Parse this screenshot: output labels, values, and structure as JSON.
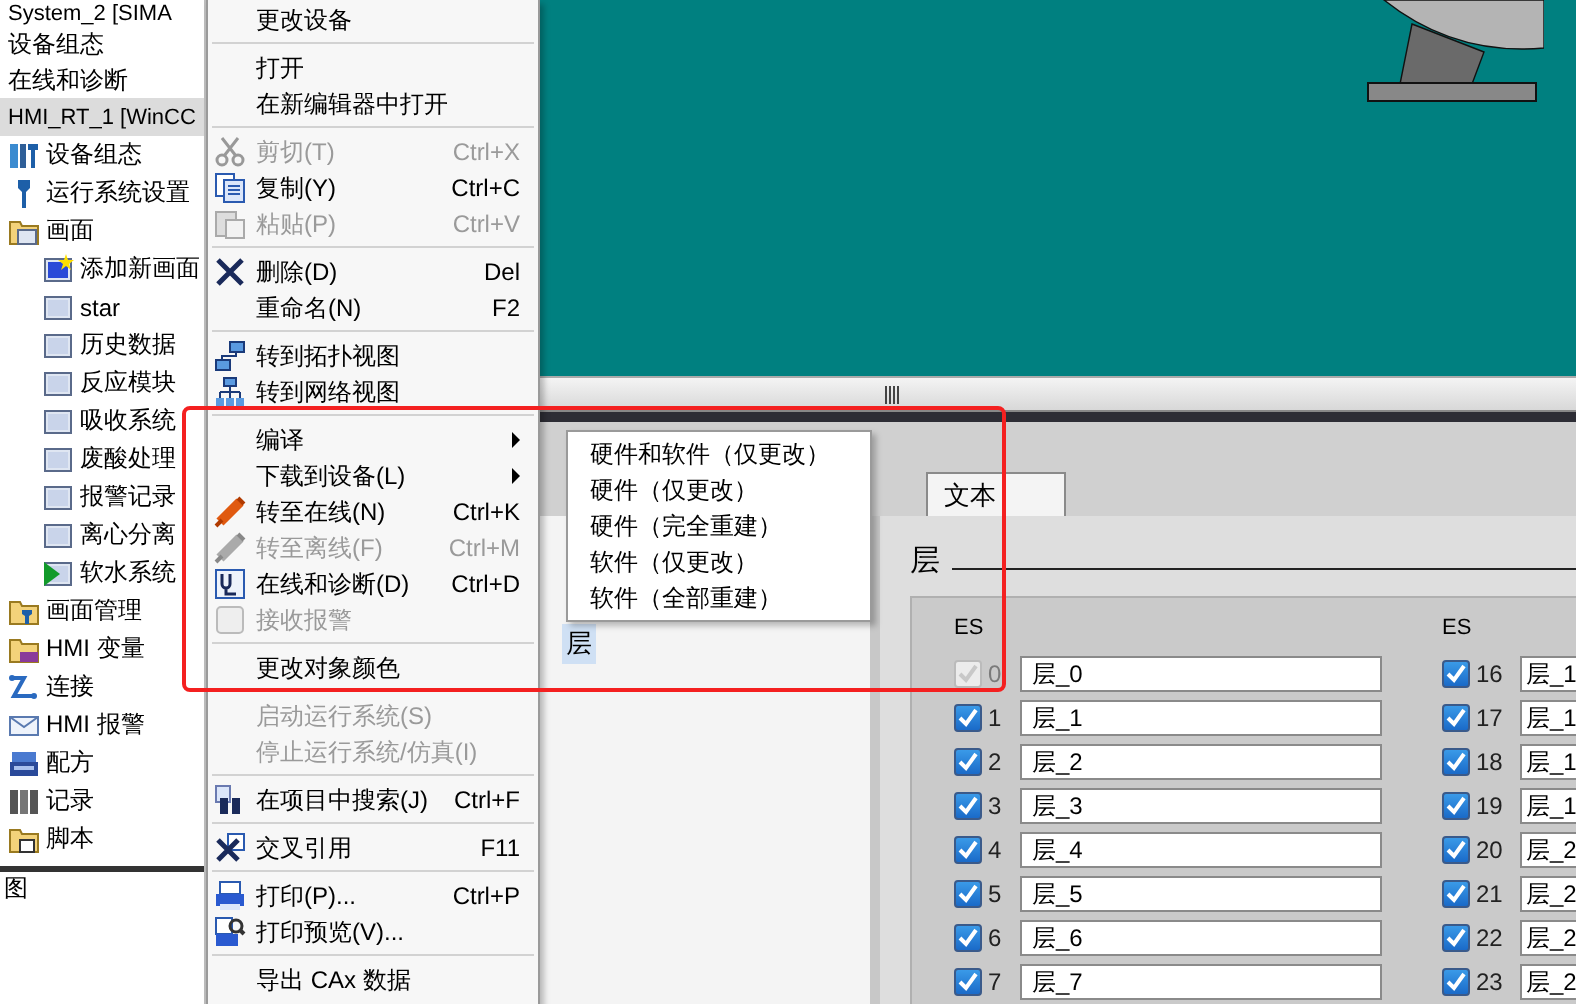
{
  "project_tree": {
    "top_items": [
      {
        "label": "System_2 [SIMA"
      },
      {
        "label": "设备组态"
      },
      {
        "label": "在线和诊断"
      }
    ],
    "device": {
      "label": "HMI_RT_1 [WinCC",
      "selected": true
    },
    "items": [
      {
        "label": "设备组态"
      },
      {
        "label": "运行系统设置"
      },
      {
        "label": "画面",
        "children": [
          {
            "label": "添加新画面",
            "start": false
          },
          {
            "label": "star",
            "start": false
          },
          {
            "label": "历史数据",
            "start": false
          },
          {
            "label": "反应模块",
            "start": false
          },
          {
            "label": "吸收系统",
            "start": false
          },
          {
            "label": "废酸处理",
            "start": false
          },
          {
            "label": "报警记录",
            "start": false
          },
          {
            "label": "离心分离",
            "start": false
          },
          {
            "label": "软水系统",
            "start": true
          }
        ]
      },
      {
        "label": "画面管理"
      },
      {
        "label": "HMI 变量"
      },
      {
        "label": "连接"
      },
      {
        "label": "HMI 报警"
      },
      {
        "label": "配方"
      },
      {
        "label": "记录"
      },
      {
        "label": "脚本"
      }
    ],
    "bottom_header": {
      "label": "图"
    }
  },
  "context_menu": {
    "items": [
      {
        "kind": "item",
        "label": "更改设备",
        "disabled": false
      },
      {
        "kind": "separator"
      },
      {
        "kind": "item",
        "label": "打开",
        "disabled": false
      },
      {
        "kind": "item",
        "label": "在新编辑器中打开",
        "disabled": false
      },
      {
        "kind": "separator"
      },
      {
        "kind": "item",
        "label": "剪切(T)",
        "shortcut": "Ctrl+X",
        "disabled": true
      },
      {
        "kind": "item",
        "label": "复制(Y)",
        "shortcut": "Ctrl+C",
        "disabled": false
      },
      {
        "kind": "item",
        "label": "粘贴(P)",
        "shortcut": "Ctrl+V",
        "disabled": true
      },
      {
        "kind": "separator"
      },
      {
        "kind": "item",
        "label": "删除(D)",
        "shortcut": "Del",
        "disabled": false
      },
      {
        "kind": "item",
        "label": "重命名(N)",
        "shortcut": "F2",
        "disabled": false
      },
      {
        "kind": "separator"
      },
      {
        "kind": "item",
        "label": "转到拓扑视图",
        "disabled": false
      },
      {
        "kind": "item",
        "label": "转到网络视图",
        "disabled": false
      },
      {
        "kind": "separator"
      },
      {
        "kind": "submenu",
        "label": "编译",
        "disabled": false
      },
      {
        "kind": "submenu",
        "label": "下载到设备(L)",
        "disabled": false
      },
      {
        "kind": "item",
        "label": "转至在线(N)",
        "shortcut": "Ctrl+K",
        "disabled": false
      },
      {
        "kind": "item",
        "label": "转至离线(F)",
        "shortcut": "Ctrl+M",
        "disabled": true
      },
      {
        "kind": "item",
        "label": "在线和诊断(D)",
        "shortcut": "Ctrl+D",
        "disabled": false
      },
      {
        "kind": "item",
        "label": "接收报警",
        "disabled": true
      },
      {
        "kind": "separator"
      },
      {
        "kind": "item",
        "label": "更改对象颜色",
        "disabled": false
      },
      {
        "kind": "separator"
      },
      {
        "kind": "item",
        "label": "启动运行系统(S)",
        "disabled": true
      },
      {
        "kind": "item",
        "label": "停止运行系统/仿真(I)",
        "disabled": true
      },
      {
        "kind": "separator"
      },
      {
        "kind": "item",
        "label": "在项目中搜索(J)",
        "shortcut": "Ctrl+F",
        "disabled": false
      },
      {
        "kind": "separator"
      },
      {
        "kind": "item",
        "label": "交叉引用",
        "shortcut": "F11",
        "disabled": false
      },
      {
        "kind": "separator"
      },
      {
        "kind": "item",
        "label": "打印(P)...",
        "shortcut": "Ctrl+P",
        "disabled": false
      },
      {
        "kind": "item",
        "label": "打印预览(V)...",
        "disabled": false
      },
      {
        "kind": "separator"
      },
      {
        "kind": "item",
        "label": "导出 CAx 数据",
        "disabled": false
      }
    ]
  },
  "compile_submenu": {
    "items": [
      {
        "label": "硬件和软件（仅更改）"
      },
      {
        "label": "硬件（仅更改）"
      },
      {
        "label": "硬件（完全重建）"
      },
      {
        "label": "软件（仅更改）"
      },
      {
        "label": "软件（全部重建）"
      }
    ]
  },
  "tabs": [
    {
      "label": "文本",
      "selected": true
    }
  ],
  "layer_list": {
    "items": [
      {
        "label": "层",
        "selected": true
      }
    ]
  },
  "layers": {
    "title": "层",
    "columns": [
      {
        "header": "ES",
        "rows": [
          {
            "number": "0",
            "checked": true,
            "disabled": true,
            "name": "层_0"
          },
          {
            "number": "1",
            "checked": true,
            "disabled": false,
            "name": "层_1"
          },
          {
            "number": "2",
            "checked": true,
            "disabled": false,
            "name": "层_2"
          },
          {
            "number": "3",
            "checked": true,
            "disabled": false,
            "name": "层_3"
          },
          {
            "number": "4",
            "checked": true,
            "disabled": false,
            "name": "层_4"
          },
          {
            "number": "5",
            "checked": true,
            "disabled": false,
            "name": "层_5"
          },
          {
            "number": "6",
            "checked": true,
            "disabled": false,
            "name": "层_6"
          },
          {
            "number": "7",
            "checked": true,
            "disabled": false,
            "name": "层_7"
          }
        ]
      },
      {
        "header": "ES",
        "rows": [
          {
            "number": "16",
            "checked": true,
            "disabled": false,
            "name": "层_1"
          },
          {
            "number": "17",
            "checked": true,
            "disabled": false,
            "name": "层_1"
          },
          {
            "number": "18",
            "checked": true,
            "disabled": false,
            "name": "层_1"
          },
          {
            "number": "19",
            "checked": true,
            "disabled": false,
            "name": "层_1"
          },
          {
            "number": "20",
            "checked": true,
            "disabled": false,
            "name": "层_2"
          },
          {
            "number": "21",
            "checked": true,
            "disabled": false,
            "name": "层_2"
          },
          {
            "number": "22",
            "checked": true,
            "disabled": false,
            "name": "层_2"
          },
          {
            "number": "23",
            "checked": true,
            "disabled": false,
            "name": "层_2"
          }
        ]
      }
    ]
  },
  "annotation": {
    "kind": "frame"
  }
}
